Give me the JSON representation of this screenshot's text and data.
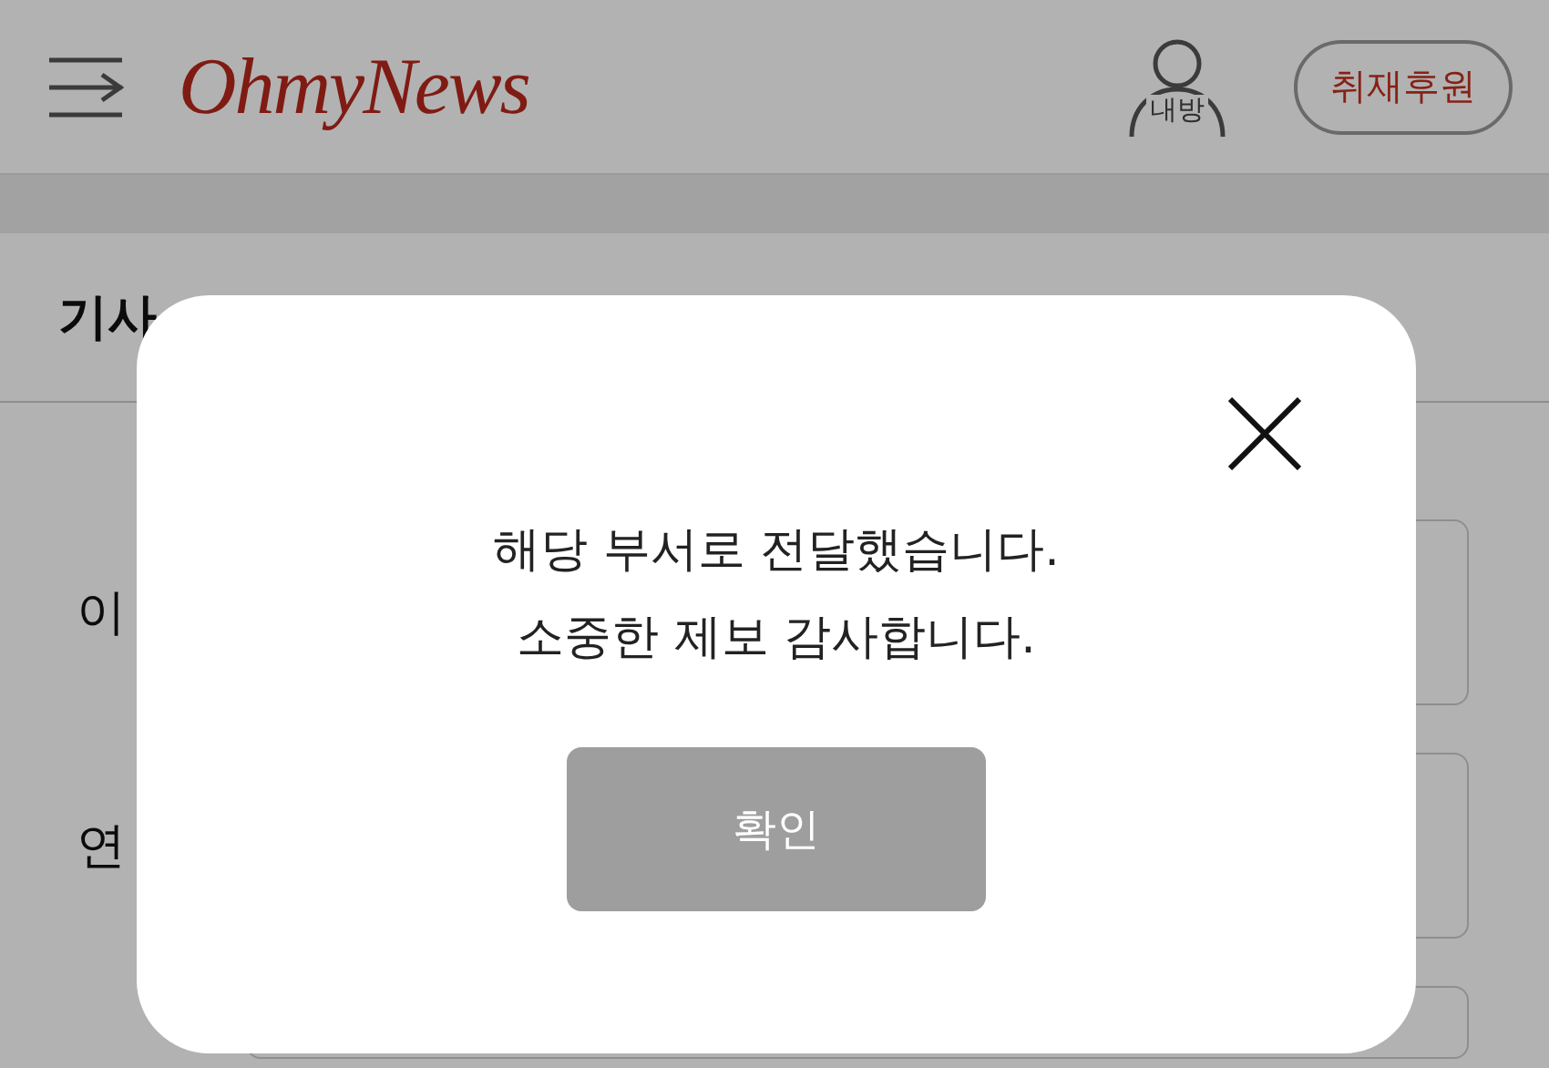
{
  "header": {
    "logo": "OhmyNews",
    "my_room": "내방",
    "support_button": "취재후원"
  },
  "section_title": "기사",
  "form": {
    "rows": [
      {
        "label": "이"
      },
      {
        "label": "연"
      },
      {}
    ]
  },
  "dialog": {
    "message": [
      "해당 부서로 전달했습니다.",
      "소중한 제보 감사합니다."
    ],
    "confirm_button": "확인"
  }
}
